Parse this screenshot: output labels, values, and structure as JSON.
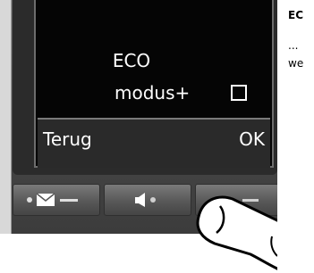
{
  "screen": {
    "title": "ECO",
    "option_label": "modus+",
    "option_checked": false,
    "softkey_left": "Terug",
    "softkey_right": "OK"
  },
  "keys": {
    "left_key_icon": "message-envelope-icon",
    "middle_key_icon": "speaker-icon",
    "right_key_icon": "right-softkey-icon"
  },
  "side_text": {
    "title": "EC",
    "line1": "...",
    "line2": "we"
  },
  "colors": {
    "screen_bg": "#050505",
    "screen_text": "#ffffff",
    "body": "#4a4a4a"
  }
}
